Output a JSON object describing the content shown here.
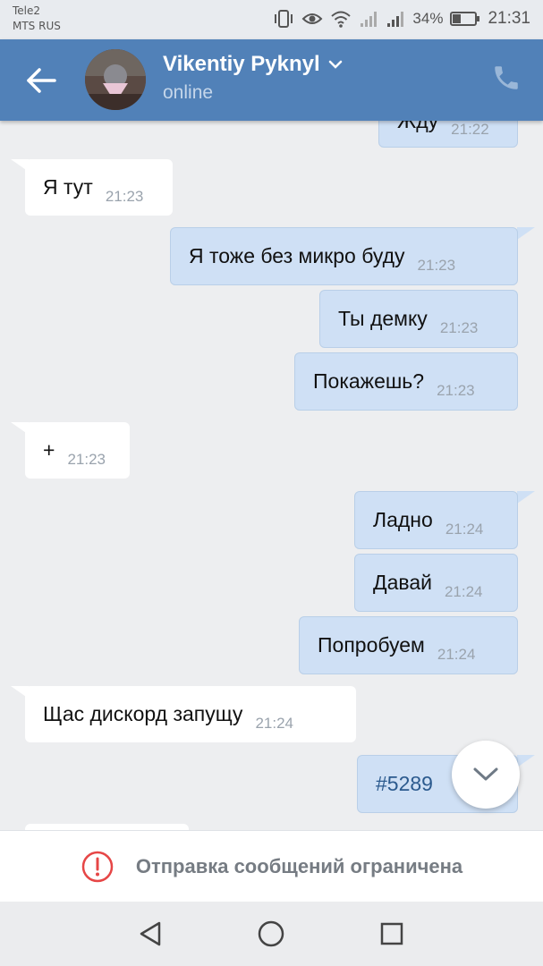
{
  "status_bar": {
    "carrier_1": "Tele2",
    "carrier_2": "MTS RUS",
    "battery_percent": "34%",
    "time": "21:31"
  },
  "header": {
    "contact_name": "Vikentiy Pyknyl",
    "status": "online"
  },
  "messages": [
    {
      "direction": "out",
      "text": "Жду",
      "time": "21:22"
    },
    {
      "direction": "in",
      "text": "Я тут",
      "time": "21:23"
    },
    {
      "direction": "out",
      "text": "Я тоже без микро буду",
      "time": "21:23"
    },
    {
      "direction": "out",
      "text": "Ты демку",
      "time": "21:23"
    },
    {
      "direction": "out",
      "text": "Покажешь?",
      "time": "21:23"
    },
    {
      "direction": "in",
      "text": "+",
      "time": "21:23"
    },
    {
      "direction": "out",
      "text": "Ладно",
      "time": "21:24"
    },
    {
      "direction": "out",
      "text": "Давай",
      "time": "21:24"
    },
    {
      "direction": "out",
      "text": "Попробуем",
      "time": "21:24"
    },
    {
      "direction": "in",
      "text": "Щас дискорд запущу",
      "time": "21:24"
    },
    {
      "direction": "out",
      "text": "#5289",
      "time": ""
    }
  ],
  "footer": {
    "restricted_text": "Отправка сообщений ограничена"
  },
  "colors": {
    "header": "#5181b8",
    "chat_background": "#edeef0",
    "outgoing_bubble": "#cfe0f5",
    "incoming_bubble": "#ffffff",
    "alert": "#e64646"
  },
  "icons": {
    "back": "back-arrow-icon",
    "call": "phone-icon",
    "scroll": "chevron-down-icon",
    "alert": "exclamation-circle-icon",
    "nav_back": "triangle-back-icon",
    "nav_home": "circle-home-icon",
    "nav_recents": "square-recents-icon"
  }
}
